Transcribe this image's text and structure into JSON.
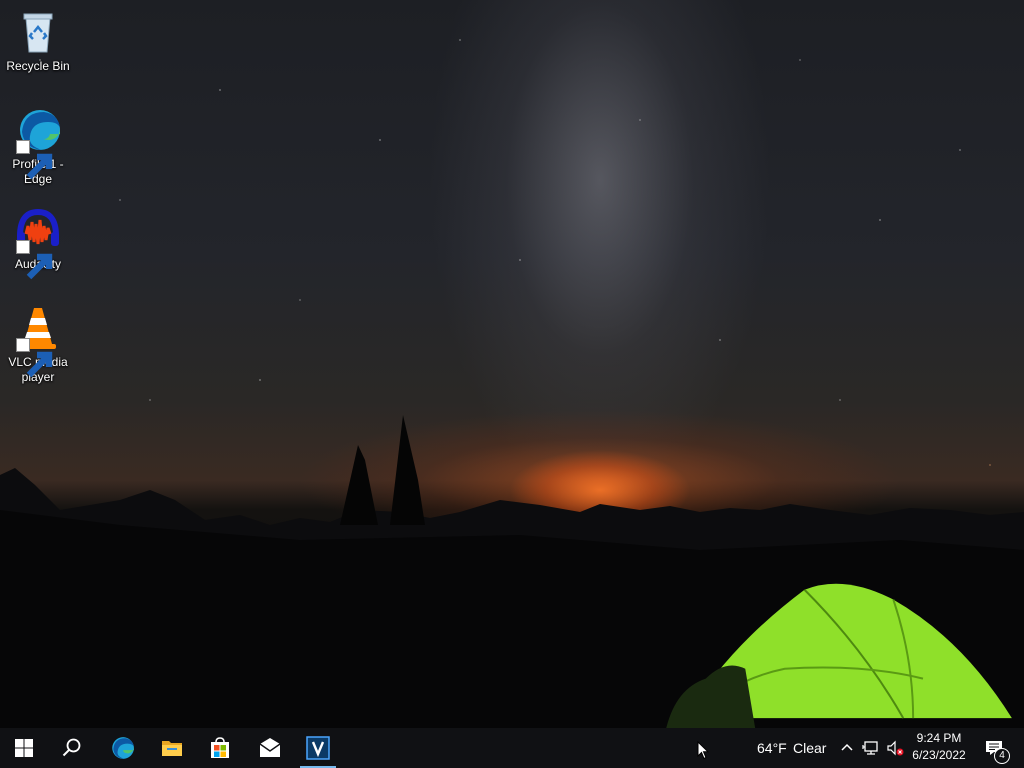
{
  "desktop": {
    "icons": [
      {
        "label": "Recycle Bin",
        "icon": "recycle-bin-icon"
      },
      {
        "label": "Profile 1 - Edge",
        "icon": "edge-icon"
      },
      {
        "label": "Audacity",
        "icon": "audacity-icon"
      },
      {
        "label": "VLC media player",
        "icon": "vlc-icon"
      }
    ]
  },
  "taskbar": {
    "pinned": [
      {
        "name": "start",
        "icon": "windows-start-icon"
      },
      {
        "name": "search",
        "icon": "search-icon"
      },
      {
        "name": "edge",
        "icon": "edge-icon"
      },
      {
        "name": "file-explorer",
        "icon": "folder-icon"
      },
      {
        "name": "microsoft-store",
        "icon": "store-icon"
      },
      {
        "name": "mail",
        "icon": "mail-icon"
      },
      {
        "name": "v-app",
        "icon": "v-app-icon"
      }
    ],
    "weather": {
      "temp": "64°F",
      "condition": "Clear"
    },
    "clock": {
      "time": "9:24 PM",
      "date": "6/23/2022"
    },
    "notifications": {
      "count": "4"
    }
  },
  "colors": {
    "taskbar_bg": "#101114",
    "accent": "#76b9ed",
    "tent_green": "#8fe02a"
  }
}
